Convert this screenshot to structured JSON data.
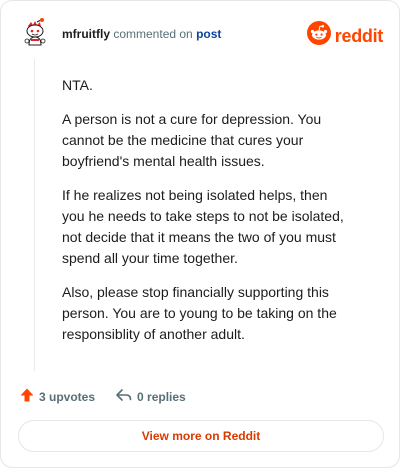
{
  "header": {
    "username": "mfruitfly",
    "action_text": "commented on",
    "post_link": "post",
    "brand_name": "reddit",
    "brand_color": "#ff4500",
    "avatar_icon": "snoo-avatar-icon",
    "brand_icon": "reddit-logo-icon"
  },
  "comment": {
    "paragraphs": [
      "NTA.",
      "A person is not a cure for depression. You cannot be the medicine that cures your boyfriend's mental health issues.",
      "If he realizes not being isolated helps, then you he needs to take steps to not be isolated, not decide that it means the two of you must spend all your time together.",
      "Also, please stop financially supporting this person. You are to young to be taking on the responsiblity of another adult."
    ]
  },
  "footer": {
    "upvotes_label": "3 upvotes",
    "upvote_icon": "upvote-arrow-icon",
    "upvote_color": "#ff4500",
    "replies_label": "0 replies",
    "reply_icon": "reply-arrow-icon",
    "view_more_label": "View more on Reddit"
  }
}
